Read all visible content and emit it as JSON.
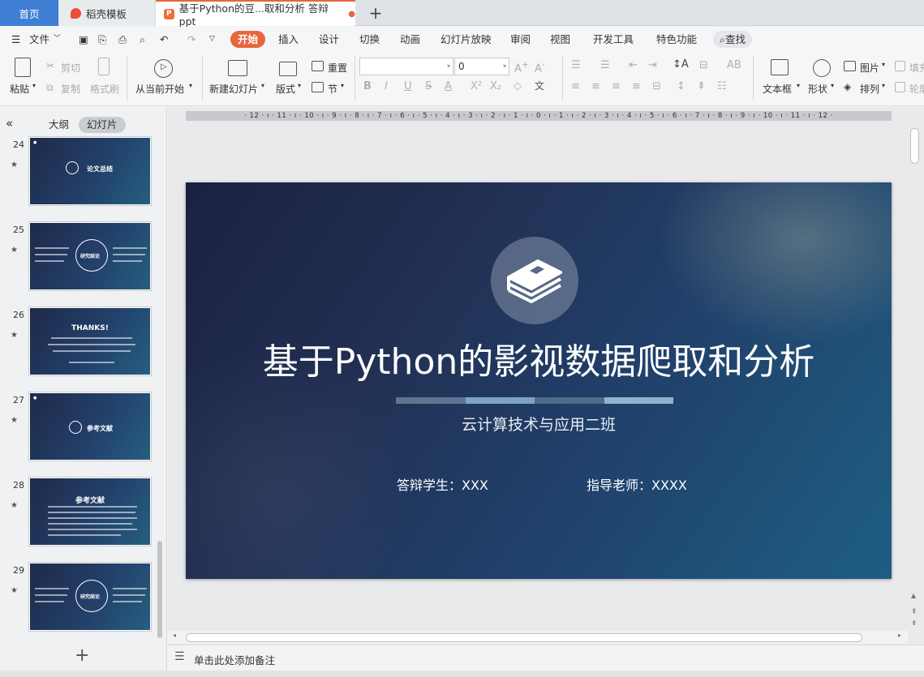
{
  "tabs": {
    "home": "首页",
    "template": "稻壳模板",
    "document": "基于Python的豆...取和分析 答辩ppt",
    "document_dot": "●",
    "add": "+"
  },
  "menu": {
    "file": "文件",
    "items": [
      "开始",
      "插入",
      "设计",
      "切换",
      "动画",
      "幻灯片放映",
      "审阅",
      "视图",
      "开发工具",
      "特色功能"
    ],
    "search": "查找"
  },
  "ribbon": {
    "paste": "粘贴",
    "cut": "剪切",
    "copy": "复制",
    "format_painter": "格式刷",
    "from_current": "从当前开始",
    "new_slide": "新建幻灯片",
    "layout": "版式",
    "reset": "重置",
    "section": "节",
    "font_size": "0",
    "textbox": "文本框",
    "shape": "形状",
    "picture": "图片",
    "arrange": "排列",
    "fill": "填充",
    "outline": "轮廓"
  },
  "panel": {
    "outline_tab": "大纲",
    "slides_tab": "幻灯片",
    "collapse_icon": "double-chevron-left-icon",
    "thumbs": [
      {
        "num": "24",
        "text": "论文总结"
      },
      {
        "num": "25",
        "text": "研究结论"
      },
      {
        "num": "26",
        "text": "THANKS!"
      },
      {
        "num": "27",
        "text": "参考文献"
      },
      {
        "num": "28",
        "text": "参考文献"
      },
      {
        "num": "29",
        "text": "研究结论"
      }
    ],
    "add": "+"
  },
  "ruler": "· 12 · ı · 11 · ı · 10 · ı · 9 · ı · 8 · ı · 7 · ı · 6 · ı · 5 · ı · 4 · ı · 3 · ı · 2 · ı · 1 · ı · 0 · ı · 1 · ı · 2 · ı · 3 · ı · 4 · ı · 5 · ı · 6 · ı · 7 · ı · 8 · ı · 9 · ı · 10 · ı · 11 · ı · 12 ·",
  "slide": {
    "title": "基于Python的影视数据爬取和分析",
    "subtitle": "云计算技术与应用二班",
    "student": "答辩学生：XXX",
    "teacher": "指导老师：XXXX",
    "bar_colors": [
      "#5a7690",
      "#7fa3c0",
      "#4d6c88",
      "#8fb4cf"
    ]
  },
  "notes": "单击此处添加备注"
}
